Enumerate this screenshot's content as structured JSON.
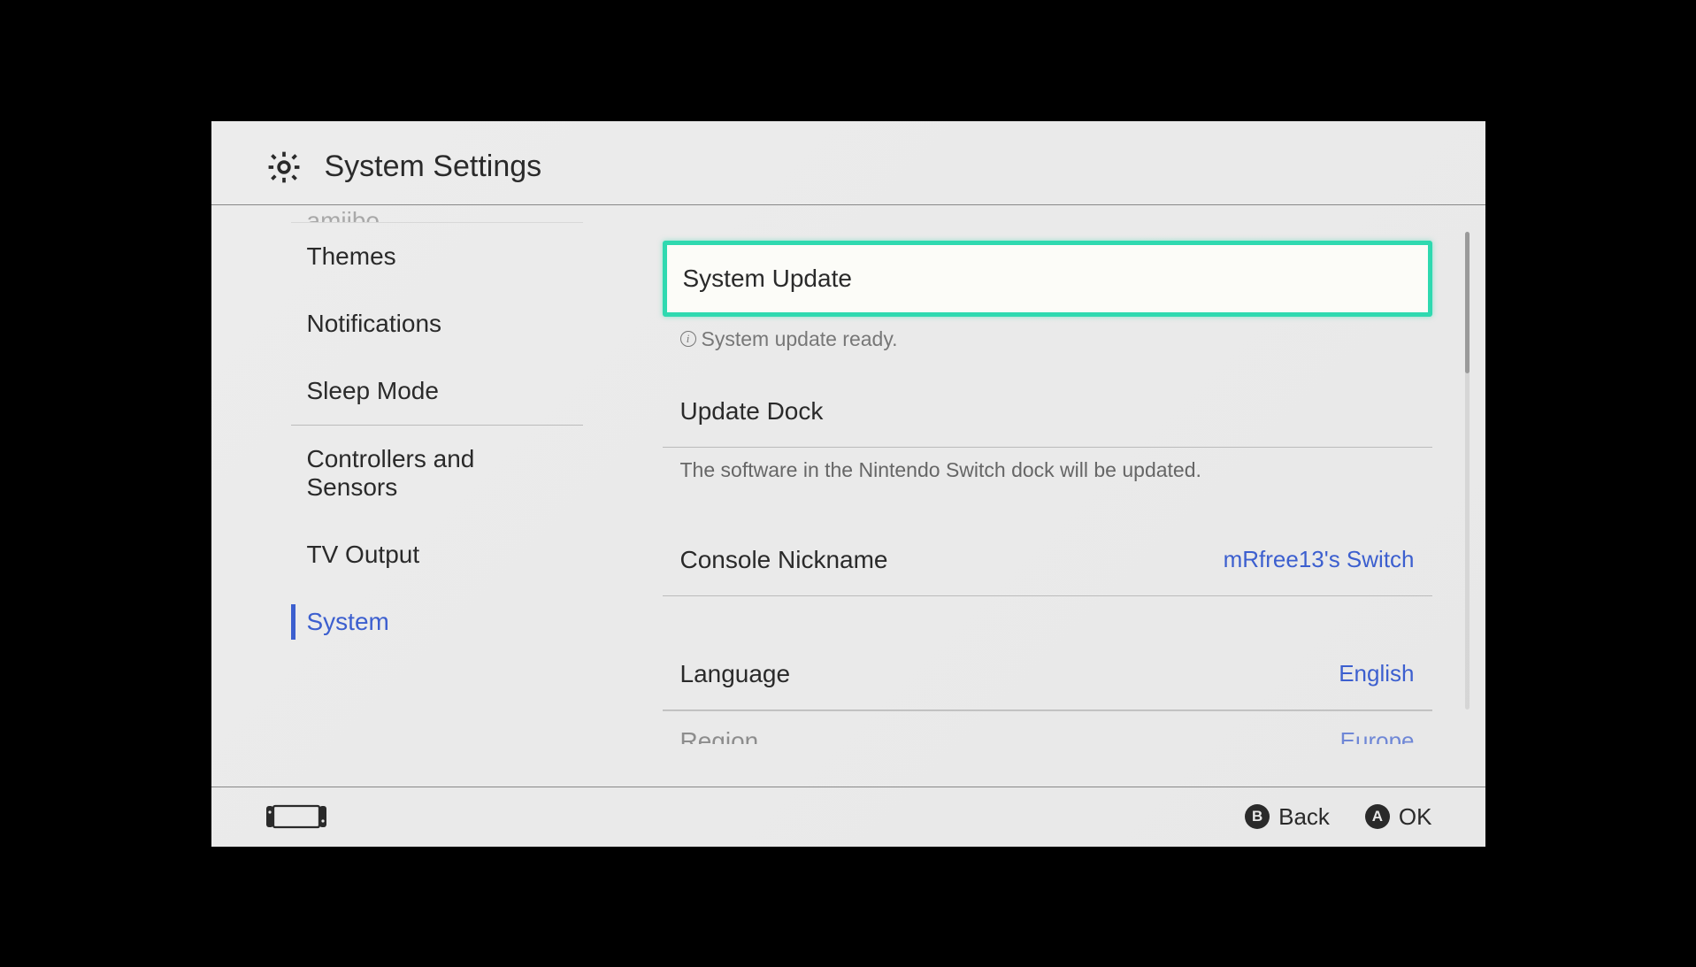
{
  "header": {
    "title": "System Settings"
  },
  "sidebar": {
    "partial_top": "amiibo",
    "items": [
      {
        "label": "Themes"
      },
      {
        "label": "Notifications"
      },
      {
        "label": "Sleep Mode"
      },
      {
        "label": "Controllers and Sensors"
      },
      {
        "label": "TV Output"
      },
      {
        "label": "System"
      }
    ],
    "selected_index": 5
  },
  "main": {
    "system_update": {
      "label": "System Update",
      "caption": "System update ready."
    },
    "update_dock": {
      "label": "Update Dock",
      "caption": "The software in the Nintendo Switch dock will be updated."
    },
    "console_nickname": {
      "label": "Console Nickname",
      "value": "mRfree13's Switch"
    },
    "language": {
      "label": "Language",
      "value": "English"
    },
    "region": {
      "label": "Region",
      "value": "Europe"
    }
  },
  "footer": {
    "b_glyph": "B",
    "b_label": "Back",
    "a_glyph": "A",
    "a_label": "OK"
  }
}
